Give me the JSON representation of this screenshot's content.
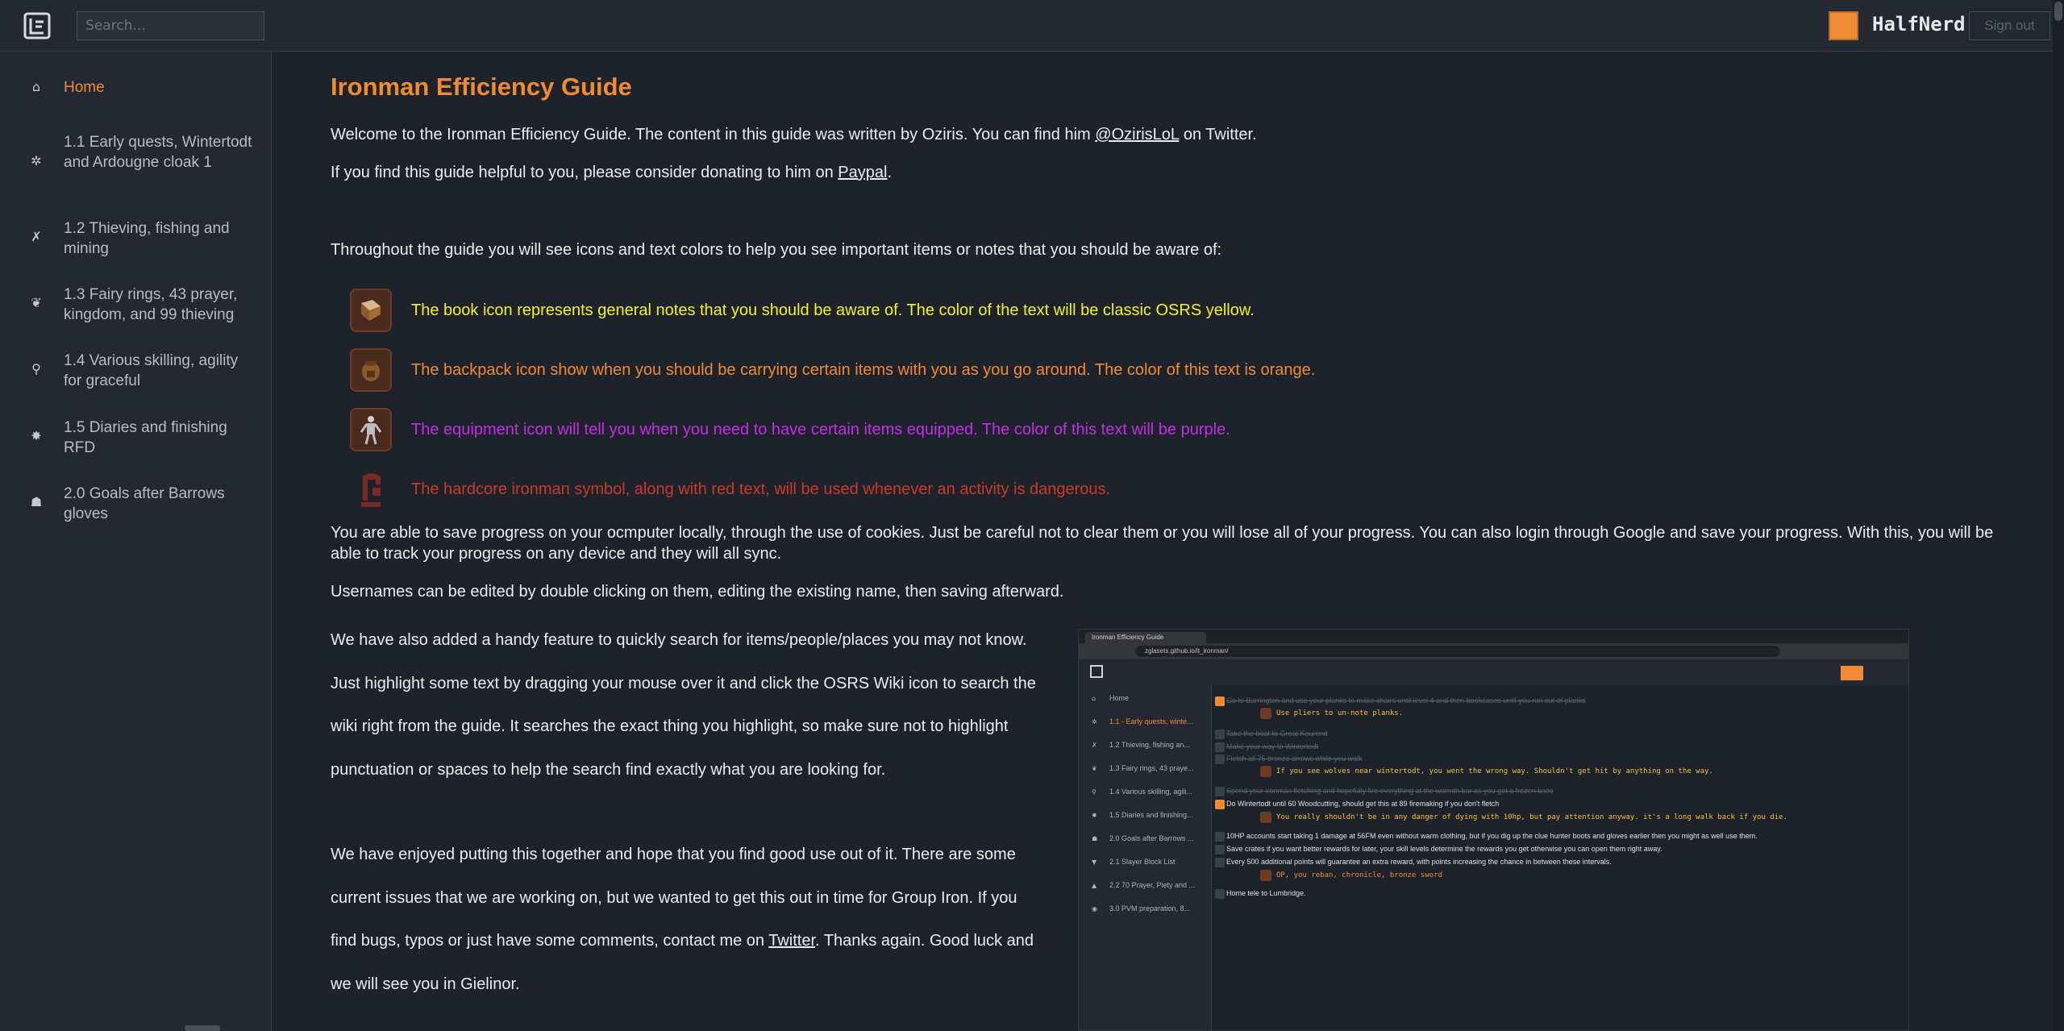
{
  "header": {
    "search_placeholder": "Search...",
    "user_name": "HalfNerd",
    "user_color": "#f08b35",
    "sign_out_label": "Sign out"
  },
  "sidebar": {
    "items": [
      {
        "label": "Home",
        "icon": "home-icon",
        "active": true
      },
      {
        "label": "1.1 Early quests, Wintertodt and Ardougne cloak 1",
        "icon": "wintertodt-icon"
      },
      {
        "label": "1.2 Thieving, fishing and mining",
        "icon": "thieving-icon"
      },
      {
        "label": "1.3 Fairy rings, 43 prayer, kingdom, and 99 thieving",
        "icon": "prayer-icon"
      },
      {
        "label": "1.4 Various skilling, agility for graceful",
        "icon": "agility-icon"
      },
      {
        "label": "1.5 Diaries and finishing RFD",
        "icon": "diary-icon"
      },
      {
        "label": "2.0 Goals after Barrows gloves",
        "icon": "barrows-icon"
      }
    ]
  },
  "main": {
    "title": "Ironman Efficiency Guide",
    "intro_1_a": "Welcome to the Ironman Efficiency Guide. The content in this guide was written by Oziris. You can find him ",
    "intro_1_link": "@OzirisLoL",
    "intro_1_b": " on Twitter.",
    "intro_2_a": "If you find this guide helpful to you, please consider donating to him on ",
    "intro_2_link": "Paypal",
    "intro_2_b": ".",
    "icons_intro": "Throughout the guide you will see icons and text colors to help you see important items or notes that you should be aware of:",
    "legend": [
      {
        "icon": "book-icon",
        "text": "The book icon represents general notes that you should be aware of. The color of the text will be classic OSRS yellow.",
        "color": "#f2f224"
      },
      {
        "icon": "backpack-icon",
        "text": "The backpack icon show when you should be carrying certain items with you as you go around. The color of this text is orange.",
        "color": "#f08b35"
      },
      {
        "icon": "equipment-icon",
        "text": "The equipment icon will tell you when you need to have certain items equipped. The color of this text will be purple.",
        "color": "#c22ee6"
      },
      {
        "icon": "hardcore-icon",
        "text": "The hardcore ironman symbol, along with red text, will be used whenever an activity is dangerous.",
        "color": "#c73a2c"
      }
    ],
    "save_para": "You are able to save progress on your ocmputer locally, through the use of cookies. Just be careful not to clear them or you will lose all of your progress. You can also login through Google and save your progress. With this, you will be able to track your progress on any device and they will all sync.",
    "usernames_para": "Usernames can be edited by double clicking on them, editing the existing name, then saving afterward.",
    "search_para": "We have also added a handy feature to quickly search for items/people/places you may not know. Just highlight some text by dragging your mouse over it and click the OSRS Wiki icon to search the wiki right from the guide. It searches the exact thing you highlight, so make sure not to highlight punctuation or spaces to help the search find exactly what you are looking for.",
    "closing_a": "We have enjoyed putting this together and hope that you find good use out of it. There are some current issues that we are working on, but we wanted to get this out in time for Group Iron. If you find bugs, typos or just have some comments, contact me on ",
    "closing_link": "Twitter",
    "closing_b": ". Thanks again. Good luck and we will see you in Gielinor."
  },
  "screenshot": {
    "tab_title": "Ironman Efficiency Guide",
    "url": "zglasets.github.io/it_ironman/",
    "nav": [
      "Home",
      "1.1 - Early quests, winte...",
      "1.2 Thieving, fishing an...",
      "1.3 Fairy rings, 43 praye...",
      "1.4 Various skilling, agili...",
      "1.5 Diaries and finishing...",
      "2.0 Goals after Barrows ...",
      "2.1 Slayer Block List",
      "2.2 70 Prayer, Piety and ...",
      "3.0 PVM preparation, 8..."
    ],
    "rows": [
      {
        "text": "Go to Barrington and use your planks to make chairs until level 4 and then bookcases until you run out of planks",
        "checked": true,
        "dim": true
      },
      {
        "note": "Use pliers to un-note planks."
      },
      {
        "text": "Take the boat to Great Kourend",
        "checked": true,
        "dim": true
      },
      {
        "text": "Make your way to Wintertodt",
        "checked": true,
        "dim": true
      },
      {
        "text": "Fletch all 75 bronze arrows while you walk",
        "checked": true,
        "dim": true
      },
      {
        "note": "If you see wolves near wintertodt, you went the wrong way. Shouldn't get hit by anything on the way."
      },
      {
        "text": "Spend your ironman fletching and hopefully fire everything at the warmth bar as you get a frozen knee",
        "checked": true,
        "dim": true
      },
      {
        "text": "Do Wintertodt until 60 Woodcutting, should get this at 89 firemaking if you don't fletch",
        "checked": false,
        "active": true
      },
      {
        "note": "You really shouldn't be in any danger of dying with 10hp, but pay attention anyway. it's a long walk back if you die."
      },
      {
        "text": "10HP accounts start taking 1 damage at 56FM even without warm clothing, but if you dig up the clue hunter boots and gloves earlier then you might as well use them."
      },
      {
        "text": "Save crates if you want better rewards for later, your skill levels determine the rewards you get otherwise you can open them right away."
      },
      {
        "text": "Every 500 additional points will guarantee an extra reward, with points increasing the chance in between these intervals."
      },
      {
        "note": "OP, you reban, chronicle, bronze sword",
        "orange": true
      },
      {
        "text": "Home tele to Lumbridge."
      }
    ]
  }
}
